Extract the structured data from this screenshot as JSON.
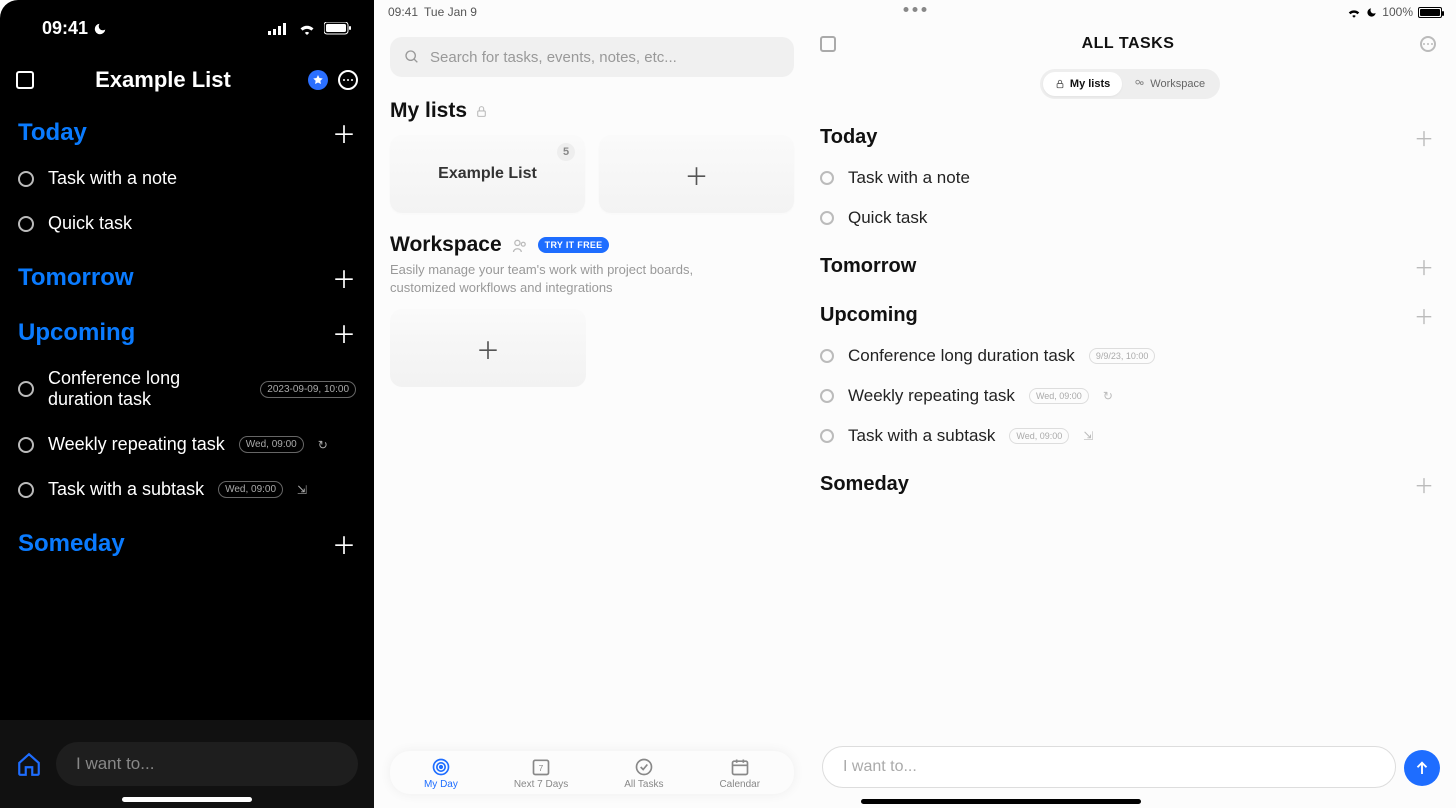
{
  "phone": {
    "status_time": "09:41",
    "list_title": "Example List",
    "sections": {
      "today": "Today",
      "tomorrow": "Tomorrow",
      "upcoming": "Upcoming",
      "someday": "Someday"
    },
    "tasks": {
      "today": [
        "Task with a note",
        "Quick task"
      ],
      "upcoming": [
        {
          "name": "Conference long duration task",
          "badge": "2023-09-09, 10:00"
        },
        {
          "name": "Weekly repeating task",
          "badge": "Wed, 09:00",
          "repeat": true
        },
        {
          "name": "Task with a subtask",
          "badge": "Wed, 09:00",
          "subtask": true
        }
      ]
    },
    "input_placeholder": "I want to..."
  },
  "tablet": {
    "status_time": "09:41",
    "status_date": "Tue Jan 9",
    "battery": "100%",
    "search_placeholder": "Search for tasks, events, notes, etc...",
    "mylists_label": "My lists",
    "example_list": {
      "name": "Example List",
      "count": "5"
    },
    "workspace": {
      "label": "Workspace",
      "try_badge": "TRY IT FREE",
      "subtitle": "Easily manage your team's work with project boards, customized workflows and integrations"
    },
    "main_title": "ALL TASKS",
    "segments": {
      "mylists": "My lists",
      "workspace": "Workspace"
    },
    "sections": {
      "today": "Today",
      "tomorrow": "Tomorrow",
      "upcoming": "Upcoming",
      "someday": "Someday"
    },
    "tasks": {
      "today": [
        "Task with a note",
        "Quick task"
      ],
      "upcoming": [
        {
          "name": "Conference long duration task",
          "badge": "9/9/23, 10:00"
        },
        {
          "name": "Weekly repeating task",
          "badge": "Wed, 09:00",
          "repeat": true
        },
        {
          "name": "Task with a subtask",
          "badge": "Wed, 09:00",
          "subtask": true
        }
      ]
    },
    "input_placeholder": "I want to...",
    "tabs": {
      "myday": "My Day",
      "next7": "Next 7 Days",
      "alltasks": "All Tasks",
      "calendar": "Calendar"
    }
  }
}
